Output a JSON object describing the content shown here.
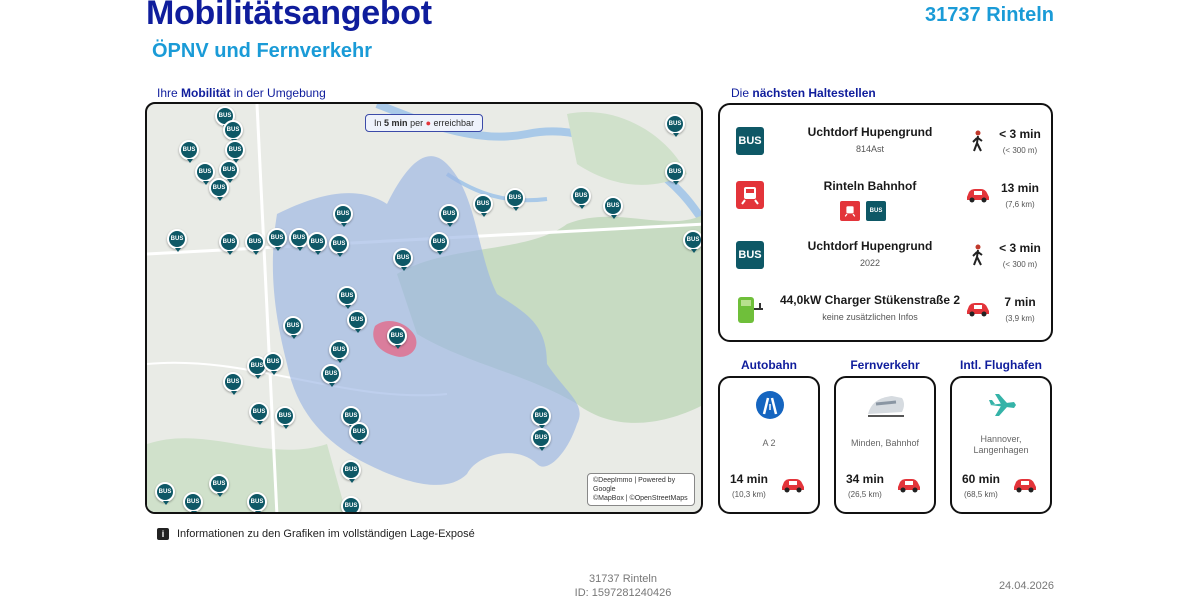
{
  "header": {
    "title": "Mobilitätsangebot",
    "subtitle": "ÖPNV und Fernverkehr",
    "location": "31737 Rinteln"
  },
  "map_section": {
    "label_prefix": "Ihre",
    "label_bold": "Mobilität",
    "label_suffix": "in der Umgebung",
    "badge_prefix": "In",
    "badge_bold": "5 min",
    "badge_middle": "per",
    "badge_suffix": "erreichbar",
    "attribution_line1": "©DeepImmo | Powered by Google",
    "attribution_line2": "©MapBox | ©OpenStreetMaps",
    "pin_label": "BUS"
  },
  "stops_section": {
    "label_prefix": "Die",
    "label_bold": "nächsten Haltestellen",
    "items": [
      {
        "icon": "bus-icon",
        "name": "Uchtdorf Hupengrund",
        "sub": "814Ast",
        "mode": "walk-icon",
        "time": "< 3 min",
        "dist": "(< 300 m)"
      },
      {
        "icon": "train-icon",
        "name": "Rinteln Bahnhof",
        "sub": "",
        "mode": "car-icon",
        "time": "13 min",
        "dist": "(7,6 km)"
      },
      {
        "icon": "bus-icon",
        "name": "Uchtdorf Hupengrund",
        "sub": "2022",
        "mode": "walk-icon",
        "time": "< 3 min",
        "dist": "(< 300 m)"
      },
      {
        "icon": "charger-icon",
        "name": "44,0kW Charger Stükenstraße 2",
        "sub": "keine zusätzlichen Infos",
        "mode": "car-icon",
        "time": "7 min",
        "dist": "(3,9 km)"
      }
    ],
    "bus_label": "BUS"
  },
  "cards": [
    {
      "title": "Autobahn",
      "icon": "motorway-icon",
      "place": "A 2",
      "time": "14 min",
      "dist": "(10,3 km)"
    },
    {
      "title": "Fernverkehr",
      "icon": "train-highspeed-icon",
      "place": "Minden, Bahnhof",
      "time": "34 min",
      "dist": "(26,5 km)"
    },
    {
      "title": "Intl. Flughafen",
      "icon": "airplane-icon",
      "place": "Hannover, Langenhagen",
      "time": "60 min",
      "dist": "(68,5 km)"
    }
  ],
  "info_text": "Informationen zu den Grafiken im vollständigen Lage-Exposé",
  "footer": {
    "location": "31737 Rinteln",
    "id": "ID: 1597281240426",
    "date": "24.04.2026"
  },
  "colors": {
    "brand_dark": "#0f1d9c",
    "brand_light": "#1a9bd7",
    "bus_teal": "#0e5866",
    "car_red": "#e3343a"
  }
}
